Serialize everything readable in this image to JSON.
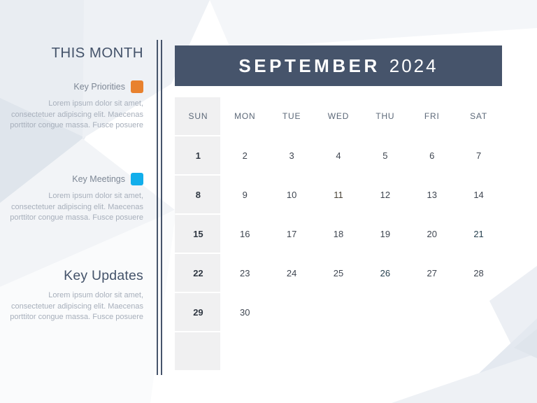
{
  "sidebar": {
    "title": "THIS MONTH",
    "legend": [
      {
        "label": "Key Priorities",
        "color": "#e8812e",
        "body": "Lorem ipsum dolor sit amet, consectetuer adipiscing elit. Maecenas porttitor congue massa. Fusce posuere"
      },
      {
        "label": "Key Meetings",
        "color": "#12aeeb",
        "body": "Lorem ipsum dolor sit amet, consectetuer adipiscing elit. Maecenas porttitor congue massa. Fusce posuere"
      }
    ],
    "key_updates": {
      "title": "Key Updates",
      "body": "Lorem ipsum dolor sit amet, consectetuer adipiscing elit. Maecenas porttitor congue massa. Fusce posuere"
    }
  },
  "calendar": {
    "month": "SEPTEMBER",
    "year": "2024",
    "header_bg": "#46546b",
    "weekday_headers": [
      "SUN",
      "MON",
      "TUE",
      "WED",
      "THU",
      "FRI",
      "SAT"
    ],
    "weeks": [
      [
        {
          "day": "1",
          "highlight": "none"
        },
        {
          "day": "2",
          "highlight": "none"
        },
        {
          "day": "3",
          "highlight": "none"
        },
        {
          "day": "4",
          "highlight": "none"
        },
        {
          "day": "5",
          "highlight": "none"
        },
        {
          "day": "6",
          "highlight": "none"
        },
        {
          "day": "7",
          "highlight": "none"
        }
      ],
      [
        {
          "day": "8",
          "highlight": "none"
        },
        {
          "day": "9",
          "highlight": "none"
        },
        {
          "day": "10",
          "highlight": "none"
        },
        {
          "day": "11",
          "highlight": "orange"
        },
        {
          "day": "12",
          "highlight": "none"
        },
        {
          "day": "13",
          "highlight": "none"
        },
        {
          "day": "14",
          "highlight": "none"
        }
      ],
      [
        {
          "day": "15",
          "highlight": "none"
        },
        {
          "day": "16",
          "highlight": "none"
        },
        {
          "day": "17",
          "highlight": "none"
        },
        {
          "day": "18",
          "highlight": "none"
        },
        {
          "day": "19",
          "highlight": "none"
        },
        {
          "day": "20",
          "highlight": "none"
        },
        {
          "day": "21",
          "highlight": "blue"
        }
      ],
      [
        {
          "day": "22",
          "highlight": "none"
        },
        {
          "day": "23",
          "highlight": "none"
        },
        {
          "day": "24",
          "highlight": "none"
        },
        {
          "day": "25",
          "highlight": "none"
        },
        {
          "day": "26",
          "highlight": "blue"
        },
        {
          "day": "27",
          "highlight": "none"
        },
        {
          "day": "28",
          "highlight": "none"
        }
      ],
      [
        {
          "day": "29",
          "highlight": "none"
        },
        {
          "day": "30",
          "highlight": "none"
        },
        {
          "day": "",
          "highlight": "none"
        },
        {
          "day": "",
          "highlight": "none"
        },
        {
          "day": "",
          "highlight": "none"
        },
        {
          "day": "",
          "highlight": "none"
        },
        {
          "day": "",
          "highlight": "none"
        }
      ],
      [
        {
          "day": "",
          "highlight": "none"
        },
        {
          "day": "",
          "highlight": "none"
        },
        {
          "day": "",
          "highlight": "none"
        },
        {
          "day": "",
          "highlight": "none"
        },
        {
          "day": "",
          "highlight": "none"
        },
        {
          "day": "",
          "highlight": "none"
        },
        {
          "day": "",
          "highlight": "none"
        }
      ]
    ]
  },
  "theme": {
    "orange": "#e8812e",
    "blue": "#12aeeb",
    "slate": "#46546b",
    "sunday_band": "#f0f0f1",
    "body_text": "#a7afbb"
  }
}
